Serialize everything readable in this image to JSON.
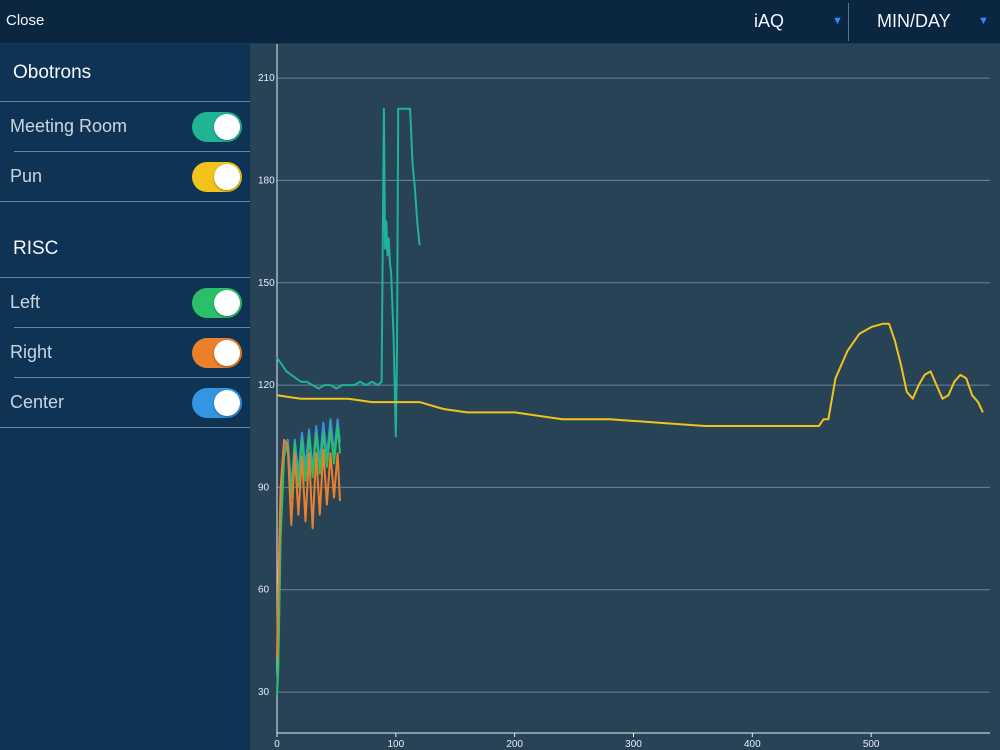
{
  "topbar": {
    "close_label": "Close",
    "metric_label": "iAQ",
    "range_label": "MIN/DAY",
    "caret_glyph": "▼",
    "caret_color": "#2f8cff"
  },
  "sidebar": {
    "groups": [
      {
        "title": "Obotrons",
        "items": [
          {
            "label": "Meeting Room",
            "on": true,
            "color": "#1fb494"
          },
          {
            "label": "Pun",
            "on": true,
            "color": "#f2c31a"
          }
        ]
      },
      {
        "title": "RISC",
        "items": [
          {
            "label": "Left",
            "on": true,
            "color": "#2bbf68"
          },
          {
            "label": "Right",
            "on": true,
            "color": "#ec7f2a"
          },
          {
            "label": "Center",
            "on": true,
            "color": "#3495e0"
          }
        ]
      }
    ]
  },
  "chart_data": {
    "type": "line",
    "title": "",
    "xlabel": "",
    "ylabel": "",
    "xlim": [
      0,
      600
    ],
    "ylim": [
      18,
      220
    ],
    "x_ticks": [
      0,
      100,
      200,
      300,
      400,
      500
    ],
    "y_ticks": [
      30,
      60,
      90,
      120,
      150,
      180,
      210
    ],
    "grid": "horizontal",
    "series": [
      {
        "color": "#1fb494",
        "x": [
          0,
          4,
          8,
          12,
          16,
          20,
          25,
          30,
          35,
          40,
          45,
          50,
          55,
          60,
          65,
          70,
          75,
          80,
          85,
          88,
          90,
          91,
          92,
          93,
          94,
          95,
          96,
          98,
          100,
          101,
          102,
          103,
          105,
          108,
          110,
          112,
          114,
          116,
          118,
          120
        ],
        "y": [
          128,
          126,
          124,
          123,
          122,
          121,
          121,
          120,
          119,
          120,
          120,
          119,
          120,
          120,
          120,
          121,
          120,
          121,
          120,
          121,
          201,
          160,
          168,
          158,
          163,
          156,
          153,
          135,
          105,
          130,
          201,
          201,
          201,
          201,
          201,
          201,
          185,
          178,
          168,
          161
        ]
      },
      {
        "color": "#f2c31a",
        "x": [
          0,
          20,
          40,
          60,
          80,
          100,
          120,
          140,
          160,
          200,
          240,
          280,
          320,
          360,
          380,
          400,
          420,
          440,
          450,
          456,
          460,
          464,
          470,
          480,
          490,
          500,
          510,
          515,
          520,
          525,
          530,
          535,
          540,
          545,
          550,
          555,
          560,
          565,
          570,
          575,
          580,
          585,
          590,
          594
        ],
        "y": [
          117,
          116,
          116,
          116,
          115,
          115,
          115,
          113,
          112,
          112,
          110,
          110,
          109,
          108,
          108,
          108,
          108,
          108,
          108,
          108,
          110,
          110,
          122,
          130,
          135,
          137,
          138,
          138,
          133,
          126,
          118,
          116,
          120,
          123,
          124,
          120,
          116,
          117,
          121,
          123,
          122,
          117,
          115,
          112
        ]
      },
      {
        "color": "#3495e0",
        "x": [
          0,
          1,
          3,
          6,
          9,
          12,
          15,
          18,
          21,
          24,
          27,
          30,
          33,
          36,
          39,
          42,
          45,
          48,
          51,
          53
        ],
        "y": [
          30,
          38,
          80,
          101,
          104,
          90,
          104,
          94,
          106,
          96,
          107,
          95,
          108,
          97,
          109,
          99,
          110,
          100,
          110,
          103
        ]
      },
      {
        "color": "#2bbf68",
        "x": [
          0,
          1,
          3,
          6,
          9,
          12,
          15,
          18,
          21,
          24,
          27,
          30,
          33,
          36,
          39,
          42,
          45,
          48,
          51,
          53
        ],
        "y": [
          29,
          36,
          75,
          99,
          103,
          87,
          103,
          90,
          104,
          92,
          105,
          93,
          106,
          94,
          106,
          96,
          107,
          97,
          108,
          100
        ]
      },
      {
        "color": "#ec7f2a",
        "x": [
          0,
          1,
          3,
          6,
          9,
          12,
          15,
          18,
          21,
          24,
          27,
          30,
          33,
          36,
          39,
          42,
          45,
          48,
          51,
          53
        ],
        "y": [
          40,
          60,
          90,
          104,
          102,
          79,
          100,
          82,
          99,
          80,
          100,
          78,
          100,
          82,
          101,
          85,
          100,
          87,
          100,
          86
        ]
      }
    ]
  }
}
